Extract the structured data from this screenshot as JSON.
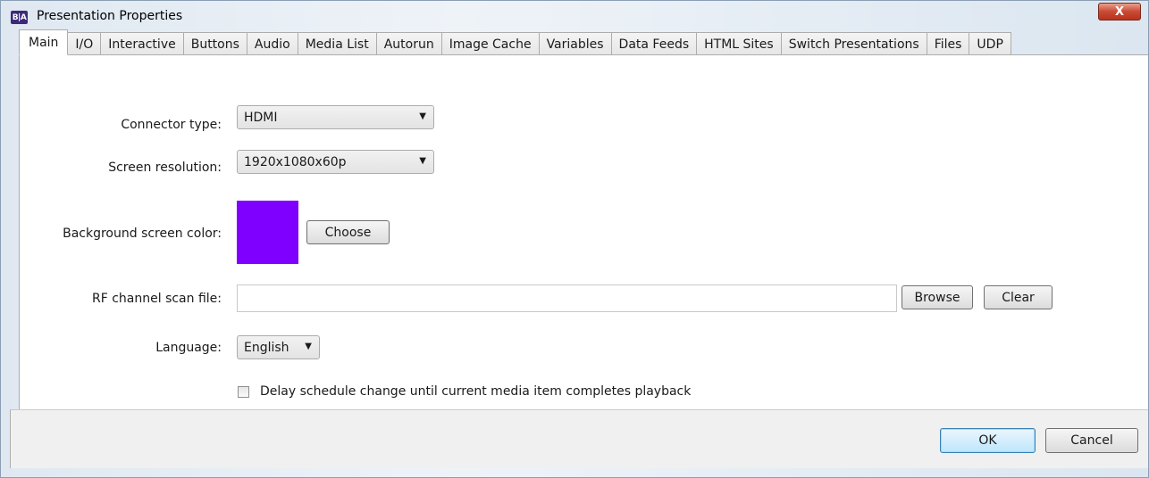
{
  "window": {
    "title": "Presentation Properties",
    "app_icon_text": "B|A",
    "close_glyph": "X"
  },
  "tabs": [
    "Main",
    "I/O",
    "Interactive",
    "Buttons",
    "Audio",
    "Media List",
    "Autorun",
    "Image Cache",
    "Variables",
    "Data Feeds",
    "HTML Sites",
    "Switch Presentations",
    "Files",
    "UDP"
  ],
  "active_tab": "Main",
  "main": {
    "connector_type": {
      "label": "Connector type:",
      "value": "HDMI"
    },
    "screen_resolution": {
      "label": "Screen resolution:",
      "value": "1920x1080x60p"
    },
    "background_color": {
      "label": "Background screen color:",
      "color": "#8000ff",
      "choose_label": "Choose"
    },
    "rf_scan_file": {
      "label": "RF channel scan file:",
      "value": "",
      "browse_label": "Browse",
      "clear_label": "Clear"
    },
    "language": {
      "label": "Language:",
      "value": "English"
    },
    "delay_schedule": {
      "label": "Delay schedule change until current media item completes playback",
      "checked": false
    }
  },
  "footer": {
    "ok_label": "OK",
    "cancel_label": "Cancel"
  }
}
